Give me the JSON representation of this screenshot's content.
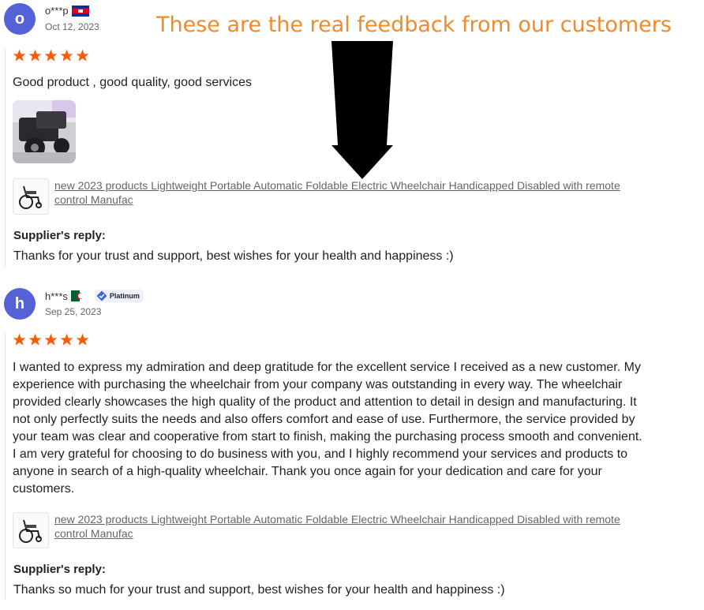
{
  "banner": "These are the real feedback from our customers",
  "colors": {
    "star": "#ff5a0a",
    "avatar": "#5561d6",
    "banner": "#ef8b2b"
  },
  "reviews": [
    {
      "avatar_letter": "o",
      "username": "o***p",
      "flag_icon": "cambodia-flag-icon",
      "date": "Oct 12, 2023",
      "rating": 5,
      "text": "Good product , good quality, good services",
      "has_photo": true,
      "product_title": "new 2023 products Lightweight Portable Automatic Foldable Electric Wheelchair Handicapped Disabled with remote control Manufac",
      "reply_label": "Supplier's reply:",
      "reply_text": "Thanks for your trust and support, best wishes for your health and happiness :)"
    },
    {
      "avatar_letter": "h",
      "username": "h***s",
      "flag_icon": "algeria-flag-icon",
      "badge": "Platinum",
      "date": "Sep 25, 2023",
      "rating": 5,
      "text": "I wanted to express my admiration and deep gratitude for the excellent service I received as a new customer. My experience with purchasing the wheelchair from your company was outstanding in every way. The wheelchair provided clearly showcases the high quality of the product and attention to detail in design and manufacturing. It not only perfectly suits the needs and also offers comfort and ease of use. Furthermore, the service provided by your team was clear and cooperative from start to finish, making the purchasing process smooth and convenient. I am very grateful for choosing to do business with you, and I highly recommend your services and products to anyone in search of a high-quality wheelchair. Thank you once again for your dedication and care for your customers.",
      "product_title": "new 2023 products Lightweight Portable Automatic Foldable Electric Wheelchair Handicapped Disabled with remote control Manufac",
      "reply_label": "Supplier's reply:",
      "reply_text": "Thanks so much for your trust and support, best wishes for your health and happiness :)"
    }
  ]
}
